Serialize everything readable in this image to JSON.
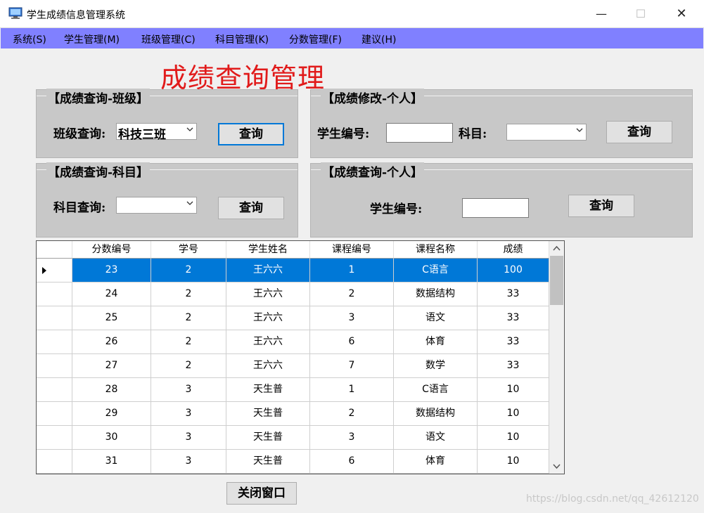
{
  "window": {
    "title": "学生成绩信息管理系统",
    "min_glyph": "—",
    "max_glyph": "☐",
    "close_glyph": "✕"
  },
  "menu": {
    "items": [
      "系统(S)",
      "学生管理(M)",
      "班级管理(C)",
      "科目管理(K)",
      "分数管理(F)",
      "建议(H)"
    ]
  },
  "page_title": "成绩查询管理",
  "groups": {
    "class_query": {
      "title": "【成绩查询-班级】",
      "label": "班级查询:",
      "selected": "科技三班",
      "button": "查询"
    },
    "personal_edit": {
      "title": "【成绩修改-个人】",
      "student_label": "学生编号:",
      "student_value": "",
      "subject_label": "科目:",
      "subject_selected": "",
      "button": "查询"
    },
    "subject_query": {
      "title": "【成绩查询-科目】",
      "label": "科目查询:",
      "selected": "",
      "button": "查询"
    },
    "personal_query": {
      "title": "【成绩查询-个人】",
      "student_label": "学生编号:",
      "student_value": "",
      "button": "查询"
    }
  },
  "table": {
    "columns": [
      "分数编号",
      "学号",
      "学生姓名",
      "课程编号",
      "课程名称",
      "成绩"
    ],
    "rows": [
      [
        "23",
        "2",
        "王六六",
        "1",
        "C语言",
        "100"
      ],
      [
        "24",
        "2",
        "王六六",
        "2",
        "数据结构",
        "33"
      ],
      [
        "25",
        "2",
        "王六六",
        "3",
        "语文",
        "33"
      ],
      [
        "26",
        "2",
        "王六六",
        "6",
        "体育",
        "33"
      ],
      [
        "27",
        "2",
        "王六六",
        "7",
        "数学",
        "33"
      ],
      [
        "28",
        "3",
        "天生普",
        "1",
        "C语言",
        "10"
      ],
      [
        "29",
        "3",
        "天生普",
        "2",
        "数据结构",
        "10"
      ],
      [
        "30",
        "3",
        "天生普",
        "3",
        "语文",
        "10"
      ],
      [
        "31",
        "3",
        "天生普",
        "6",
        "体育",
        "10"
      ]
    ],
    "selected_row": 0
  },
  "close_button": "关闭窗口",
  "watermark": "https://blog.csdn.net/qq_42612120",
  "colors": {
    "menubar": "#8080ff",
    "title_red": "#e11b1b",
    "selection": "#0078d7",
    "group_bg": "#c8c8c8"
  }
}
